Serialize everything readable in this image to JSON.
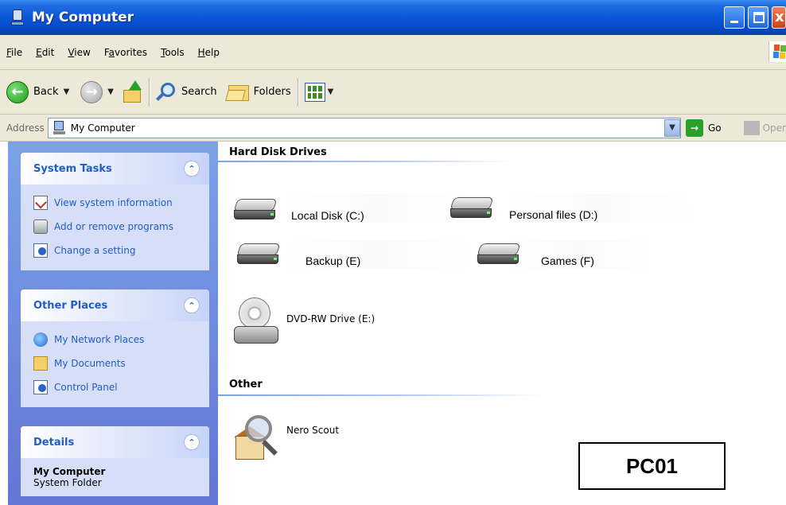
{
  "window": {
    "title": "My Computer",
    "colors": {
      "titlebar": "#0a56d8",
      "sidebar": "#6f8ce0",
      "link": "#215dc6"
    }
  },
  "menu": [
    {
      "label": "File",
      "ul": "F",
      "rest": "ile"
    },
    {
      "label": "Edit",
      "ul": "E",
      "rest": "dit"
    },
    {
      "label": "View",
      "ul": "V",
      "rest": "iew"
    },
    {
      "label": "Favorites",
      "pre": "F",
      "ul": "a",
      "rest": "vorites"
    },
    {
      "label": "Tools",
      "ul": "T",
      "rest": "ools"
    },
    {
      "label": "Help",
      "ul": "H",
      "rest": "elp"
    }
  ],
  "toolbar": {
    "back_label": "Back",
    "search_label": "Search",
    "folders_label": "Folders",
    "icons": [
      "back-icon",
      "forward-icon",
      "up-folder-icon",
      "search-icon",
      "folders-icon",
      "views-icon"
    ]
  },
  "address": {
    "label": "Address",
    "value": "My Computer",
    "go_label": "Go",
    "open_label": "Oper"
  },
  "sidebar": {
    "system_tasks": {
      "title": "System Tasks",
      "items": [
        {
          "label": "View system information",
          "icon": "system-info-icon"
        },
        {
          "label": "Add or remove programs",
          "icon": "add-remove-programs-icon"
        },
        {
          "label": "Change a setting",
          "icon": "control-panel-icon"
        }
      ]
    },
    "other_places": {
      "title": "Other Places",
      "items": [
        {
          "label": "My Network Places",
          "icon": "network-places-icon"
        },
        {
          "label": "My Documents",
          "icon": "my-documents-icon"
        },
        {
          "label": "Control Panel",
          "icon": "control-panel-icon"
        }
      ]
    },
    "details": {
      "title": "Details",
      "name": "My Computer",
      "type": "System Folder"
    }
  },
  "content": {
    "hard_disk_header": "Hard Disk Drives",
    "drives": [
      {
        "label": "Local Disk (C:)",
        "icon": "hard-drive-icon"
      },
      {
        "label": "Personal files (D:)",
        "icon": "hard-drive-icon"
      },
      {
        "label": "Backup (E)",
        "icon": "hard-drive-icon"
      },
      {
        "label": "Games (F)",
        "icon": "hard-drive-icon"
      }
    ],
    "dvd_label": "DVD-RW Drive (E:)",
    "other_header": "Other",
    "nero_label": "Nero Scout"
  },
  "overlay_label": "PC01"
}
